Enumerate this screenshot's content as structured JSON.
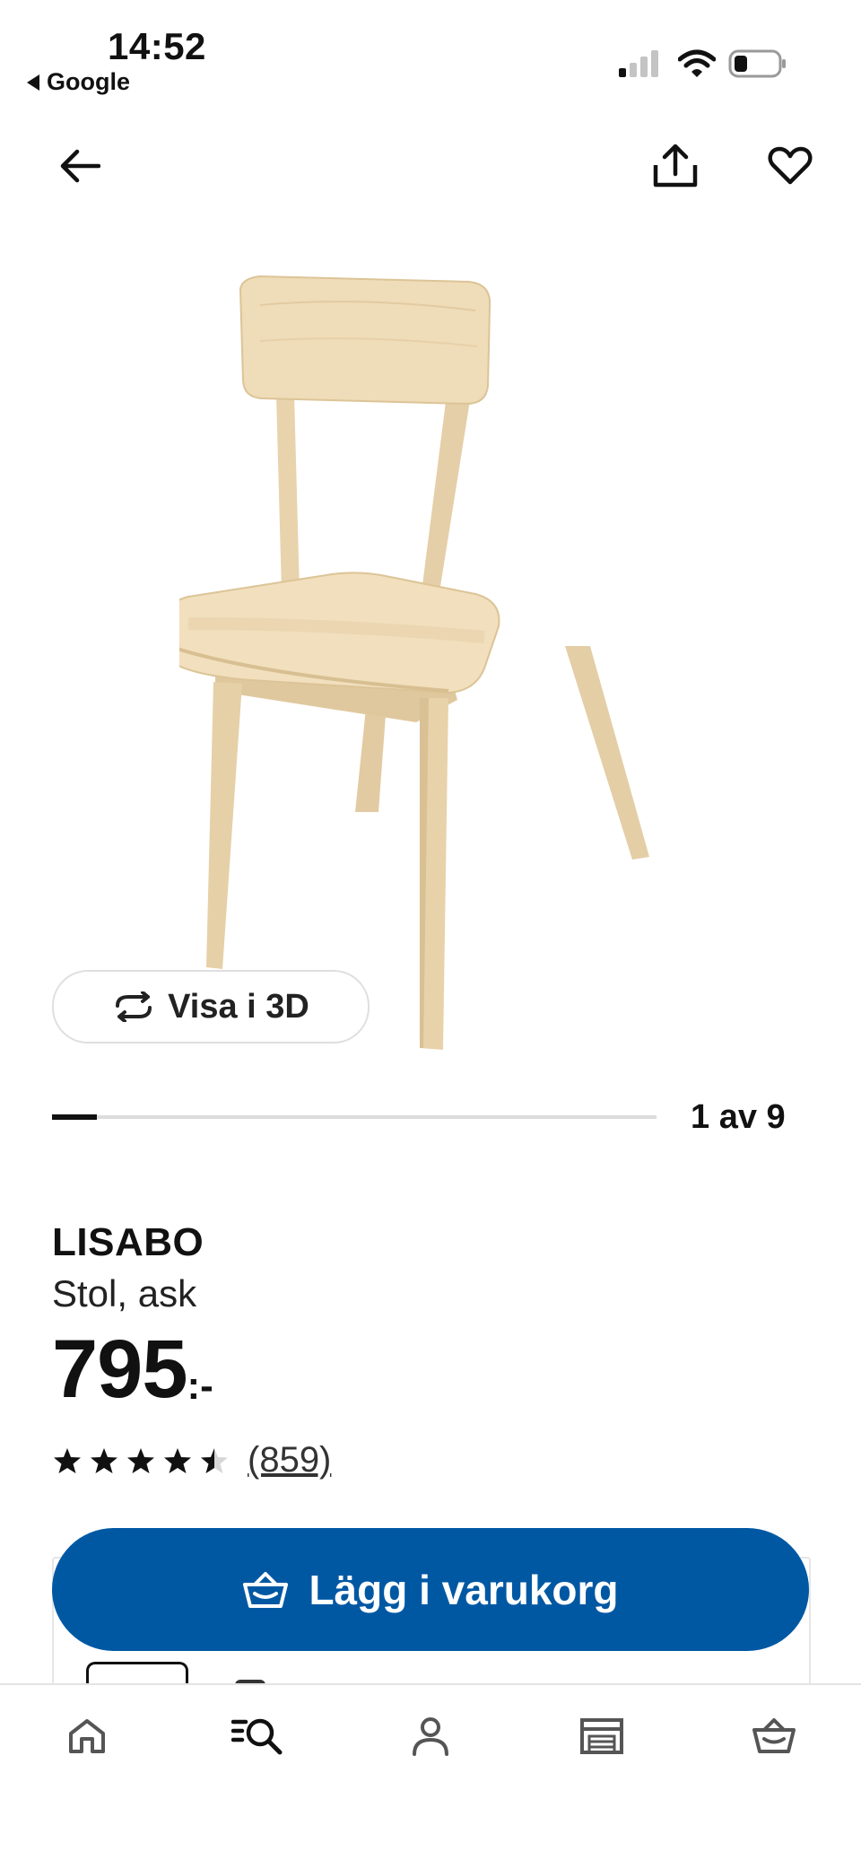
{
  "status_bar": {
    "time": "14:52",
    "back_app": "Google"
  },
  "top_bar": {
    "back_icon": "arrow-left-icon",
    "share_icon": "share-icon",
    "favorite_icon": "heart-icon"
  },
  "gallery": {
    "view_3d_label": "Visa i 3D",
    "counter": "1 av 9",
    "current": 1,
    "total": 9
  },
  "product": {
    "name": "LISABO",
    "description": "Stol, ask",
    "price_integer": "795",
    "price_suffix": ":-",
    "rating": 4.5,
    "rating_max": 5,
    "review_count": "(859)"
  },
  "actions": {
    "add_to_cart_label": "Lägg i varukorg"
  },
  "bottom_nav": {
    "items": [
      {
        "name": "home",
        "icon": "home-icon"
      },
      {
        "name": "search",
        "icon": "search-icon",
        "active": true
      },
      {
        "name": "profile",
        "icon": "profile-icon"
      },
      {
        "name": "stores",
        "icon": "store-icon"
      },
      {
        "name": "cart",
        "icon": "cart-icon"
      }
    ]
  },
  "colors": {
    "primary": "#0058a3",
    "text": "#111111",
    "track": "#dcdcdc",
    "wood": "#ead6b0"
  }
}
